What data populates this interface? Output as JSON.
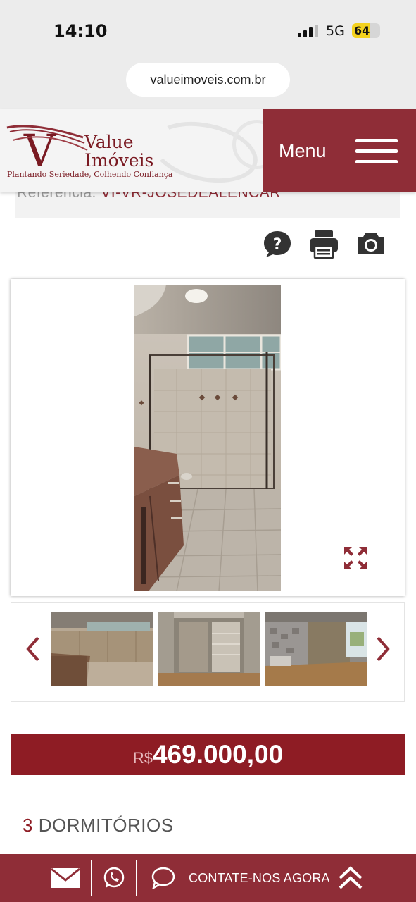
{
  "status_bar": {
    "time": "14:10",
    "network": "5G",
    "battery": "64",
    "battery_level_percent": 64,
    "signal_bars_of_4": 3
  },
  "browser": {
    "url": "valueimoveis.com.br"
  },
  "header": {
    "brand_line1": "Value",
    "brand_line2": "Imóveis",
    "brand_initial": "V",
    "tagline": "Plantando Seriedade, Colhendo Confiança",
    "menu_label": "Menu",
    "colors": {
      "brand": "#8f2d37",
      "price_bg": "#8e1c24"
    }
  },
  "reference": {
    "label": "Referência:",
    "value": "VI-VR-JOSEDEALENCAR"
  },
  "tools": [
    {
      "icon": "help-icon"
    },
    {
      "icon": "print-icon"
    },
    {
      "icon": "camera-icon"
    }
  ],
  "gallery": {
    "main_photo": "bathroom-photo",
    "expand_icon": "expand-icon",
    "prev_icon": "chevron-left-icon",
    "next_icon": "chevron-right-icon",
    "thumbnails": [
      "kitchen-thumb",
      "closet-thumb",
      "room-thumb"
    ]
  },
  "price": {
    "currency": "R$",
    "amount": "469.000,00"
  },
  "features": {
    "bedrooms_count": "3",
    "bedrooms_label": "DORMITÓRIOS"
  },
  "bottom_bar": {
    "icons": [
      "mail-icon",
      "whatsapp-icon",
      "chat-icon",
      "double-chevron-up-icon"
    ],
    "contact_label": "CONTATE-NOS AGORA"
  }
}
